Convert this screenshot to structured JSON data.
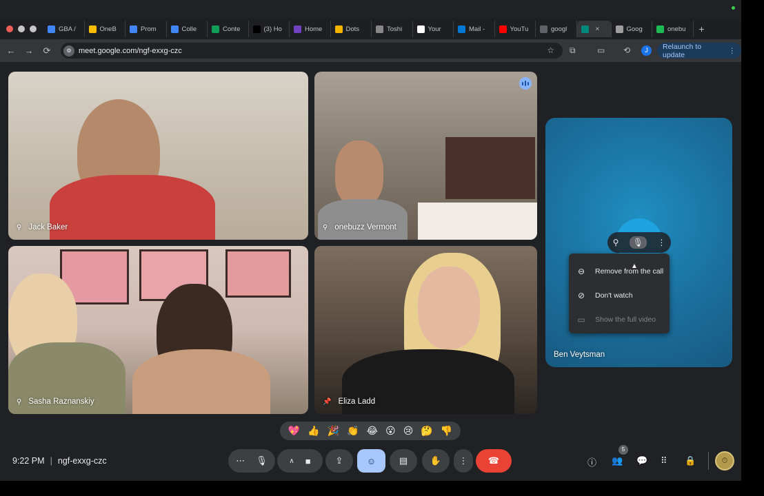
{
  "browser": {
    "tabs": [
      {
        "label": "GBA /",
        "color": "#4285f4"
      },
      {
        "label": "OneB",
        "color": "#fbbc04"
      },
      {
        "label": "Prom",
        "color": "#4285f4"
      },
      {
        "label": "Colle",
        "color": "#4285f4"
      },
      {
        "label": "Conte",
        "color": "#0f9d58"
      },
      {
        "label": "(3) Ho",
        "color": "#000000"
      },
      {
        "label": "Home",
        "color": "#6f42c1"
      },
      {
        "label": "Dots",
        "color": "#f4b400"
      },
      {
        "label": "Toshi",
        "color": "#888888"
      },
      {
        "label": "Your",
        "color": "#ffffff"
      },
      {
        "label": "Mail -",
        "color": "#0078d4"
      },
      {
        "label": "YouTu",
        "color": "#ff0000"
      },
      {
        "label": "googl",
        "color": "#5f6368"
      },
      {
        "label": "",
        "color": "#00897b"
      },
      {
        "label": "Goog",
        "color": "#9e9e9e"
      },
      {
        "label": "onebu",
        "color": "#1db954"
      }
    ],
    "new_tab": "+",
    "url": "meet.google.com/ngf-exxg-czc",
    "avatar_initial": "J",
    "relaunch_label": "Relaunch to update"
  },
  "participants": [
    {
      "name": "Jack Baker"
    },
    {
      "name": "onebuzz Vermont"
    },
    {
      "name": "Sasha Raznanskiy"
    },
    {
      "name": "Eliza Ladd"
    },
    {
      "name": "Ben Veytsman"
    }
  ],
  "context_menu": {
    "items": [
      {
        "label": "Remove from the call",
        "icon": "remove-circle-icon",
        "disabled": false
      },
      {
        "label": "Don't watch",
        "icon": "video-off-icon",
        "disabled": false
      },
      {
        "label": "Show the full video",
        "icon": "full-video-icon",
        "disabled": true
      }
    ]
  },
  "reactions": [
    "💖",
    "👍",
    "🎉",
    "👏",
    "😂",
    "😮",
    "😢",
    "🤔",
    "👎"
  ],
  "footer": {
    "time": "9:22 PM",
    "separator": "|",
    "meeting_code": "ngf-exxg-czc",
    "people_count": "5"
  },
  "colors": {
    "accent": "#a8c7fa",
    "end_call": "#ea4335",
    "background": "#202124"
  }
}
